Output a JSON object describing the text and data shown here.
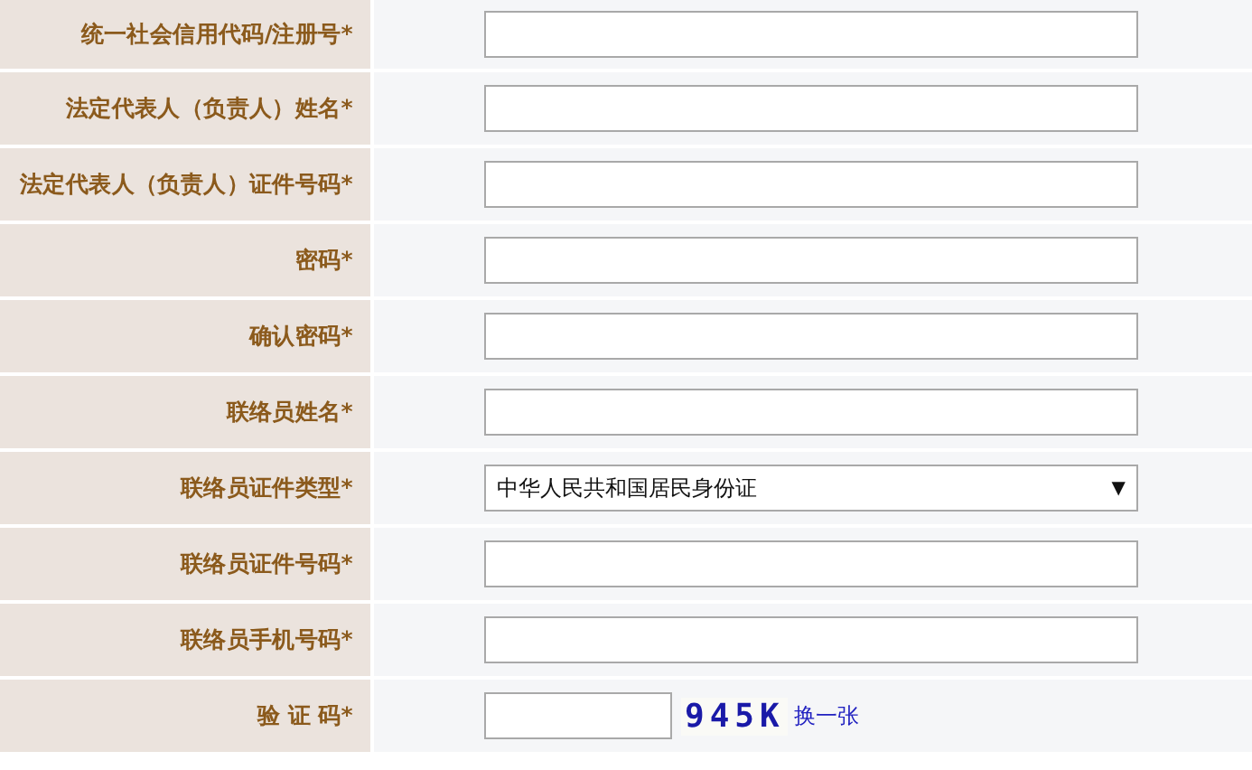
{
  "form": {
    "rows": [
      {
        "label": "统一社会信用代码/注册号*",
        "kind": "text"
      },
      {
        "label": "法定代表人（负责人）姓名*",
        "kind": "text"
      },
      {
        "label": "法定代表人（负责人）证件号码*",
        "kind": "text"
      },
      {
        "label": "密码*",
        "kind": "text"
      },
      {
        "label": "确认密码*",
        "kind": "text"
      },
      {
        "label": "联络员姓名*",
        "kind": "text"
      },
      {
        "label": "联络员证件类型*",
        "kind": "select",
        "value": "中华人民共和国居民身份证",
        "arrow": "▼"
      },
      {
        "label": "联络员证件号码*",
        "kind": "text"
      },
      {
        "label": "联络员手机号码*",
        "kind": "text"
      },
      {
        "label": "验 证 码*",
        "kind": "captcha",
        "code": "945K",
        "refresh": "换一张"
      }
    ]
  }
}
